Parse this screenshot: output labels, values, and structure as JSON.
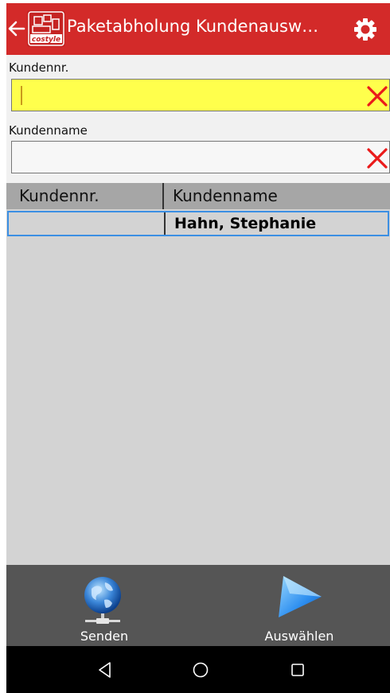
{
  "header": {
    "title": "Paketabholung Kundenausw…",
    "logo_text": "costyle",
    "colors": {
      "bar": "#d32a29"
    }
  },
  "form": {
    "customer_no_label": "Kundennr.",
    "customer_no_value": "",
    "customer_name_label": "Kundenname",
    "customer_name_value": ""
  },
  "table": {
    "columns": [
      "Kundennr.",
      "Kundenname"
    ],
    "rows": [
      {
        "kundennr": "",
        "kundenname": "Hahn, Stephanie",
        "selected": true
      }
    ]
  },
  "bottom_bar": {
    "send_label": "Senden",
    "select_label": "Auswählen"
  },
  "system_nav": {
    "icons": [
      "back-icon",
      "home-icon",
      "recents-icon"
    ]
  }
}
